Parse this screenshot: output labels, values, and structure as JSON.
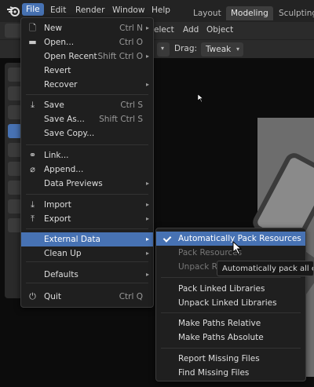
{
  "topbar": {
    "menus": [
      "File",
      "Edit",
      "Render",
      "Window",
      "Help"
    ],
    "workspaces": [
      "Layout",
      "Modeling",
      "Sculpting"
    ]
  },
  "header": {
    "partial_menus": [
      "elect",
      "Add",
      "Object"
    ],
    "drag_label": "Drag:",
    "drag_value": "Tweak"
  },
  "file_menu": {
    "items": [
      {
        "label": "New",
        "shortcut": "Ctrl N",
        "icon": "new-file-icon",
        "arrow": true
      },
      {
        "label": "Open...",
        "shortcut": "Ctrl O",
        "icon": "folder-icon"
      },
      {
        "label": "Open Recent",
        "shortcut": "Shift Ctrl O",
        "arrow": true
      },
      {
        "label": "Revert"
      },
      {
        "label": "Recover",
        "arrow": true
      },
      {
        "label": "Save",
        "shortcut": "Ctrl S",
        "icon": "save-icon"
      },
      {
        "label": "Save As...",
        "shortcut": "Shift Ctrl S"
      },
      {
        "label": "Save Copy..."
      },
      {
        "label": "Link...",
        "icon": "link-icon"
      },
      {
        "label": "Append...",
        "icon": "append-icon"
      },
      {
        "label": "Data Previews",
        "arrow": true
      },
      {
        "label": "Import",
        "icon": "import-icon",
        "arrow": true
      },
      {
        "label": "Export",
        "icon": "export-icon",
        "arrow": true
      },
      {
        "label": "External Data",
        "arrow": true,
        "highlighted": true
      },
      {
        "label": "Clean Up",
        "arrow": true
      },
      {
        "label": "Defaults",
        "arrow": true
      },
      {
        "label": "Quit",
        "shortcut": "Ctrl Q",
        "icon": "power-icon"
      }
    ]
  },
  "external_data_menu": {
    "items": [
      {
        "label": "Automatically Pack Resources",
        "checked": true,
        "highlighted": true
      },
      {
        "label": "Pack Resources",
        "disabled": true
      },
      {
        "label": "Unpack R",
        "disabled": true
      },
      {
        "label": "Pack Linked Libraries"
      },
      {
        "label": "Unpack Linked Libraries"
      },
      {
        "label": "Make Paths Relative"
      },
      {
        "label": "Make Paths Absolute"
      },
      {
        "label": "Report Missing Files"
      },
      {
        "label": "Find Missing Files"
      }
    ]
  },
  "tooltip": {
    "text": "Automatically pack all ext"
  },
  "colors": {
    "accent": "#4772b3",
    "menu_bg": "#1f1f1f",
    "topbar_bg": "#232323"
  }
}
